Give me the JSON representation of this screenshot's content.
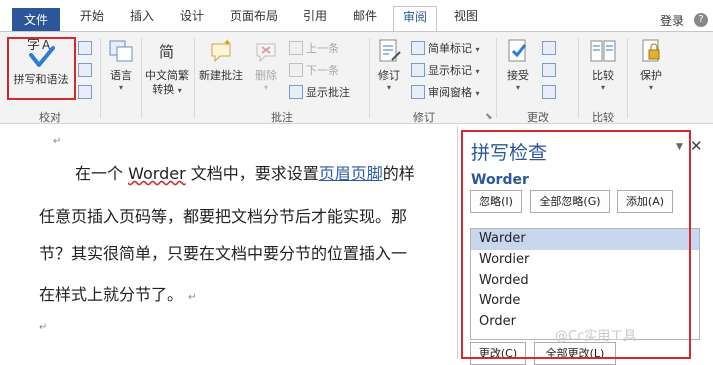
{
  "tabs": [
    "文件",
    "开始",
    "插入",
    "设计",
    "页面布局",
    "引用",
    "邮件",
    "审阅",
    "视图"
  ],
  "active_tab": "审阅",
  "login": "登录",
  "help": "?",
  "ribbon": {
    "proofing": {
      "spell_icon_text": "字A",
      "spell_label": "拼写和语法",
      "group_label": "校对"
    },
    "language": {
      "label": "语言"
    },
    "chinese": {
      "label1": "中文简繁",
      "label2": "转换",
      "icon_text": "简"
    },
    "new_comment": {
      "label": "新建批注"
    },
    "delete": {
      "label": "删除"
    },
    "previous": {
      "label": "上一条"
    },
    "next": {
      "label": "下一条"
    },
    "show_comments": {
      "label": "显示批注"
    },
    "comments_group": "批注",
    "track": {
      "label": "修订"
    },
    "simple_markup": {
      "label": "简单标记"
    },
    "show_markup": {
      "label": "显示标记"
    },
    "review_pane": {
      "label": "审阅窗格"
    },
    "tracking_group": "修订",
    "accept": {
      "label": "接受"
    },
    "changes_group": "更改",
    "compare": {
      "label": "比较",
      "group_label": "比较"
    },
    "protect": {
      "label": "保护"
    }
  },
  "document": {
    "cut_line": "…",
    "para_mark": "↵",
    "lines": {
      "l1_a": "在一个 ",
      "l1_b": "Worder",
      "l1_c": " 文档中，要求设置",
      "l1_d": "页眉页脚",
      "l1_e": "的样",
      "l2": "任意页插入页码等，都要把文档分节后才能实现。那",
      "l3": "节？其实很简单，只要在文档中要分节的位置插入一",
      "l4": "在样式上就分节了。"
    }
  },
  "spell_pane": {
    "title": "拼写检查",
    "word": "Worder",
    "ignore": "忽略(I)",
    "ignore_all": "全部忽略(G)",
    "add": "添加(A)",
    "suggestions": [
      "Warder",
      "Wordier",
      "Worded",
      "Worde",
      "Order"
    ],
    "selected": "Warder",
    "change": "更改(C)",
    "change_all": "全部更改(L)"
  },
  "watermark": "@Cc实用工具"
}
